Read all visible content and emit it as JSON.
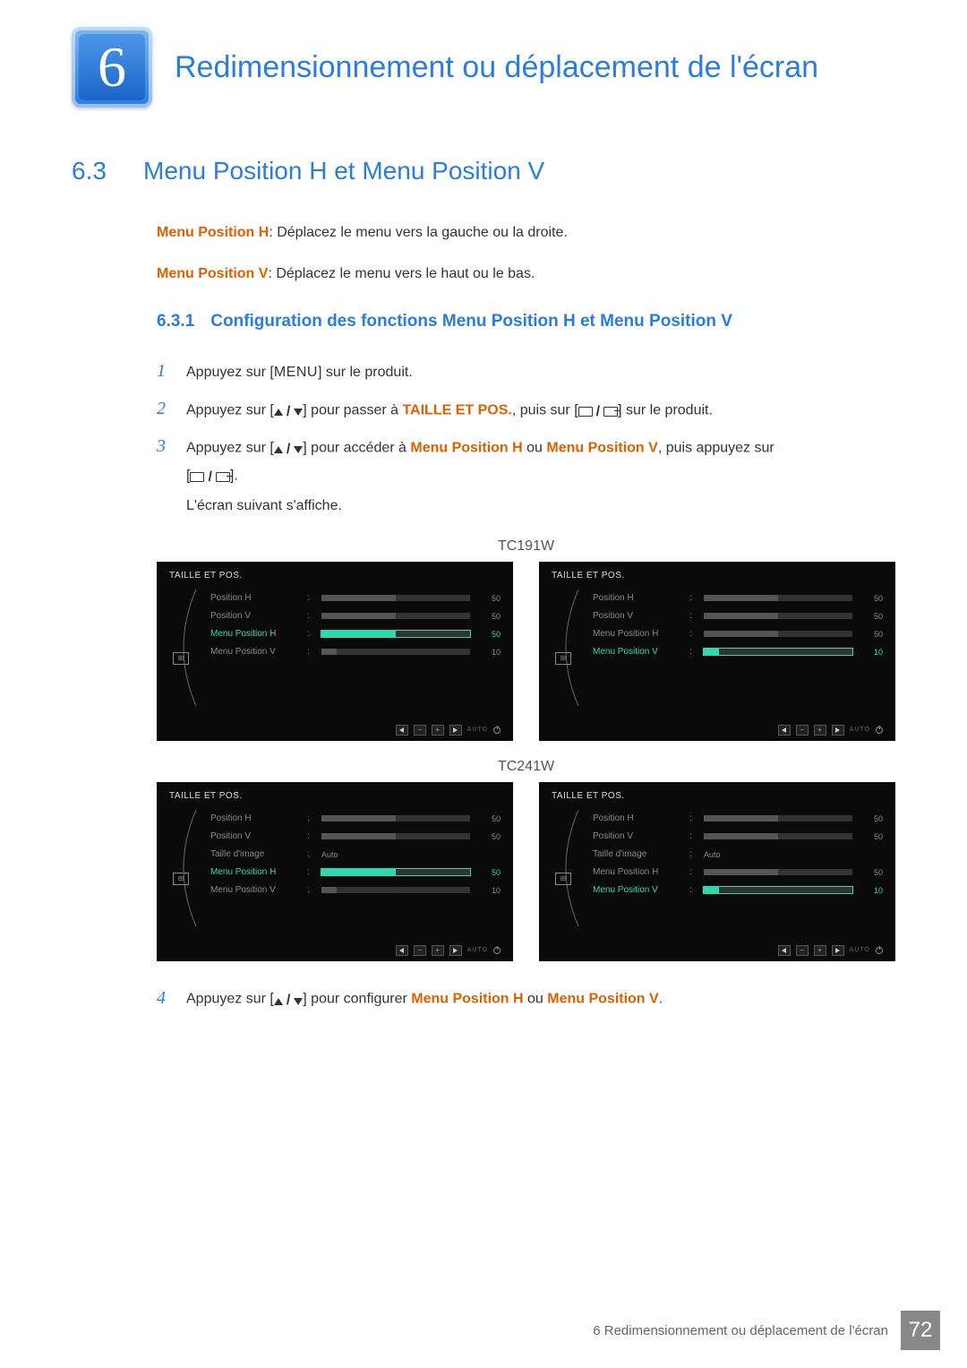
{
  "chapter": {
    "number": "6",
    "title": "Redimensionnement ou déplacement de l'écran"
  },
  "section": {
    "number": "6.3",
    "title": "Menu Position H et Menu Position V"
  },
  "definitions": {
    "h": {
      "term": "Menu Position H",
      "text": ": Déplacez le menu vers la gauche ou la droite."
    },
    "v": {
      "term": "Menu Position V",
      "text": ": Déplacez le menu vers le haut ou le bas."
    }
  },
  "subsection": {
    "number": "6.3.1",
    "title": "Configuration des fonctions Menu Position H et Menu Position V"
  },
  "steps": {
    "s1": {
      "num": "1",
      "pre": "Appuyez sur [",
      "btn": "MENU",
      "post": "] sur le produit."
    },
    "s2": {
      "num": "2",
      "pre": "Appuyez sur [",
      "mid": "] pour passer à ",
      "kw": "TAILLE ET POS.",
      "post1": ", puis sur [",
      "post2": "] sur le produit."
    },
    "s3": {
      "num": "3",
      "pre": "Appuyez sur [",
      "mid": "] pour accéder à ",
      "kw1": "Menu Position H",
      "or": " ou ",
      "kw2": "Menu Position V",
      "post1": ", puis appuyez sur",
      "post2": "[",
      "post3": "].",
      "follow": "L'écran suivant s'affiche."
    },
    "s4": {
      "num": "4",
      "pre": "Appuyez sur [",
      "mid": "] pour configurer ",
      "kw1": "Menu Position H",
      "or": " ou ",
      "kw2": "Menu Position V",
      "post": "."
    }
  },
  "models": {
    "a": "TC191W",
    "b": "TC241W"
  },
  "osd": {
    "title": "TAILLE ET POS.",
    "rows4": [
      {
        "lbl": "Position H",
        "val": "50",
        "fill": 50
      },
      {
        "lbl": "Position V",
        "val": "50",
        "fill": 50
      },
      {
        "lbl": "Menu Position H",
        "val": "50",
        "fill": 50
      },
      {
        "lbl": "Menu Position V",
        "val": "10",
        "fill": 10
      }
    ],
    "rows5": [
      {
        "lbl": "Position H",
        "val": "50",
        "fill": 50
      },
      {
        "lbl": "Position V",
        "val": "50",
        "fill": 50
      },
      {
        "lbl": "Taille d'image",
        "auto": "Auto"
      },
      {
        "lbl": "Menu Position H",
        "val": "50",
        "fill": 50
      },
      {
        "lbl": "Menu Position V",
        "val": "10",
        "fill": 10
      }
    ],
    "footer": {
      "minus": "−",
      "plus": "+",
      "auto": "AUTO"
    }
  },
  "footer": {
    "text": "6 Redimensionnement ou déplacement de l'écran",
    "page": "72"
  }
}
